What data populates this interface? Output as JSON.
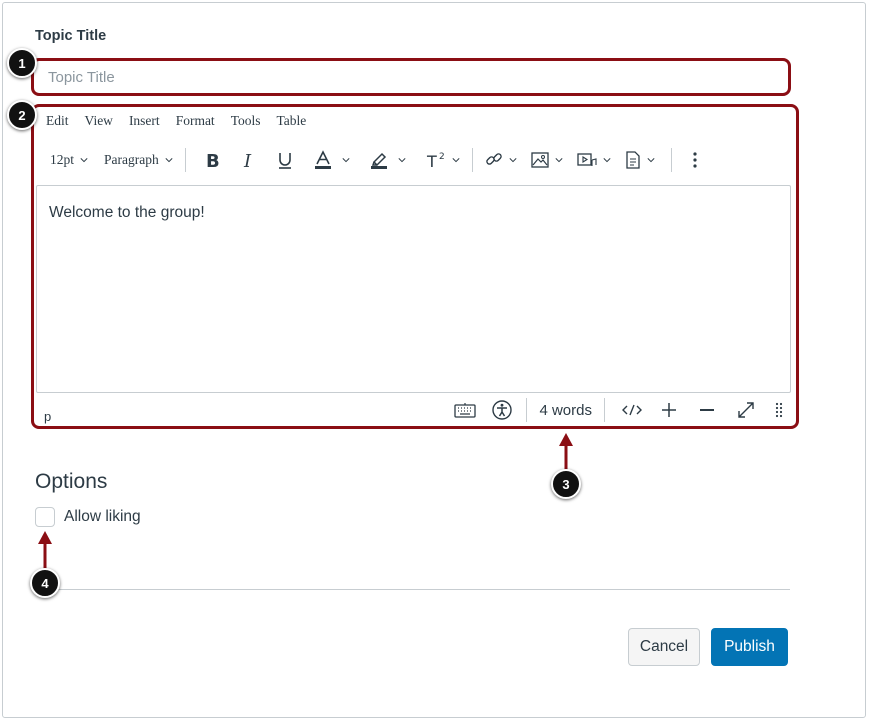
{
  "form": {
    "topic_title_label": "Topic Title",
    "topic_title_placeholder": "Topic Title",
    "topic_title_value": ""
  },
  "editor": {
    "menu": [
      "Edit",
      "View",
      "Insert",
      "Format",
      "Tools",
      "Table"
    ],
    "font_size": "12pt",
    "block_format": "Paragraph",
    "toolbar_icons": [
      "bold-icon",
      "italic-icon",
      "underline-icon",
      "text-color-icon",
      "highlight-icon",
      "superscript-icon",
      "link-icon",
      "image-icon",
      "media-icon",
      "document-icon",
      "more-options-icon"
    ],
    "content_text": "Welcome to the group!",
    "path": "p",
    "word_count": "4 words",
    "status_icons": [
      "keyboard-icon",
      "accessibility-icon",
      "html-editor-icon",
      "zoom-in-icon",
      "zoom-out-icon",
      "fullscreen-icon",
      "resize-handle-icon"
    ]
  },
  "options": {
    "heading": "Options",
    "allow_liking_label": "Allow liking",
    "allow_liking_checked": false
  },
  "actions": {
    "cancel_label": "Cancel",
    "publish_label": "Publish"
  },
  "callouts": [
    "1",
    "2",
    "3",
    "4"
  ],
  "colors": {
    "callout_outline": "#8b0e14",
    "primary_button": "#0374b5",
    "text": "#2d3b45",
    "border": "#c7cdd1"
  }
}
